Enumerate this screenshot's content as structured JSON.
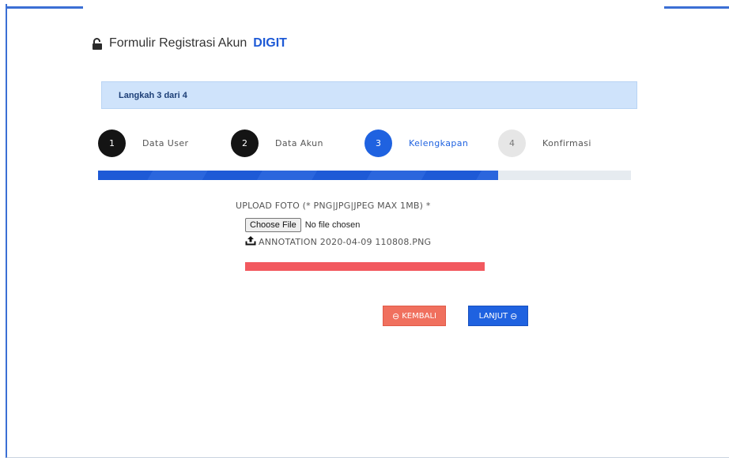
{
  "header": {
    "title_prefix": "Formulir Registrasi Akun",
    "title_brand": "DIGIT"
  },
  "banner": {
    "step_text": "Langkah 3 dari 4"
  },
  "steps": [
    {
      "number": "1",
      "label": "Data User",
      "state": "done"
    },
    {
      "number": "2",
      "label": "Data Akun",
      "state": "done"
    },
    {
      "number": "3",
      "label": "Kelengkapan",
      "state": "active"
    },
    {
      "number": "4",
      "label": "Konfirmasi",
      "state": "pending"
    }
  ],
  "progress": {
    "fraction": 0.75
  },
  "upload": {
    "label": "UPLOAD FOTO (* PNG|JPG|JPEG MAX 1MB) *",
    "choose_button": "Choose File",
    "no_file_text": "No file chosen",
    "uploaded_file": "ANNOTATION 2020-04-09 110808.PNG"
  },
  "buttons": {
    "back_label": "KEMBALI",
    "next_label": "LANJUT"
  },
  "colors": {
    "accent": "#1f62e0",
    "done_step": "#141414",
    "back_button": "#f0705e",
    "error_bar": "#f2595f",
    "banner_bg": "#cfe3fb"
  },
  "icons": {
    "title": "unlocked-lock-icon",
    "uploaded_file": "upload-tray-icon",
    "back": "arrow-left-circle-icon",
    "next": "arrow-right-circle-icon"
  }
}
